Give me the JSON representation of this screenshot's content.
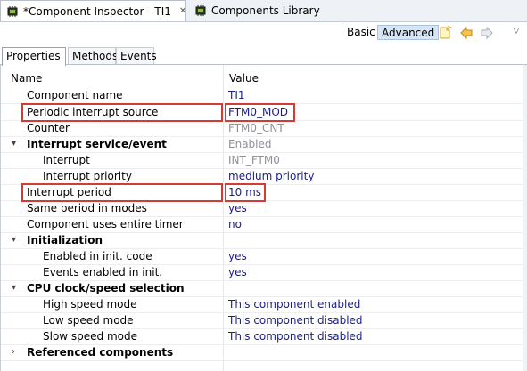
{
  "tabs": {
    "active_label": "*Component Inspector - TI1",
    "active_close": "✕",
    "inactive_label": "Components Library"
  },
  "toolbar": {
    "basic_label": "Basic",
    "advanced_label": "Advanced",
    "icons": [
      "new-note-icon",
      "back-arrow-icon",
      "forward-arrow-icon",
      "view-menu-icon"
    ],
    "view_menu_glyph": "▽"
  },
  "property_tabs": [
    "Properties",
    "Methods",
    "Events"
  ],
  "grid": {
    "header_name": "Name",
    "header_value": "Value",
    "rows": [
      {
        "name": "Component name",
        "value": "TI1"
      },
      {
        "name": "Periodic interrupt source",
        "value": "FTM0_MOD"
      },
      {
        "name": "Counter",
        "value": "FTM0_CNT"
      },
      {
        "name": "Interrupt service/event",
        "value": "Enabled",
        "arrow": "▾"
      },
      {
        "name": "Interrupt",
        "value": "INT_FTM0"
      },
      {
        "name": "Interrupt priority",
        "value": "medium priority"
      },
      {
        "name": "Interrupt period",
        "value": "10 ms"
      },
      {
        "name": "Same period in modes",
        "value": "yes"
      },
      {
        "name": "Component uses entire timer",
        "value": "no"
      },
      {
        "name": "Initialization",
        "value": "",
        "arrow": "▾"
      },
      {
        "name": "Enabled in init. code",
        "value": "yes"
      },
      {
        "name": "Events enabled in init.",
        "value": "yes"
      },
      {
        "name": "CPU clock/speed selection",
        "value": "",
        "arrow": "▾"
      },
      {
        "name": "High speed mode",
        "value": "This component enabled"
      },
      {
        "name": "Low speed mode",
        "value": "This component disabled"
      },
      {
        "name": "Slow speed mode",
        "value": "This component disabled"
      },
      {
        "name": "Referenced components",
        "value": "",
        "arrow": "›"
      }
    ]
  },
  "colors": {
    "highlight": "#d33c34",
    "value_text": "#1a1f8c",
    "disabled_text": "#8d9197",
    "selected_mode_bg": "#d7e6f6"
  }
}
